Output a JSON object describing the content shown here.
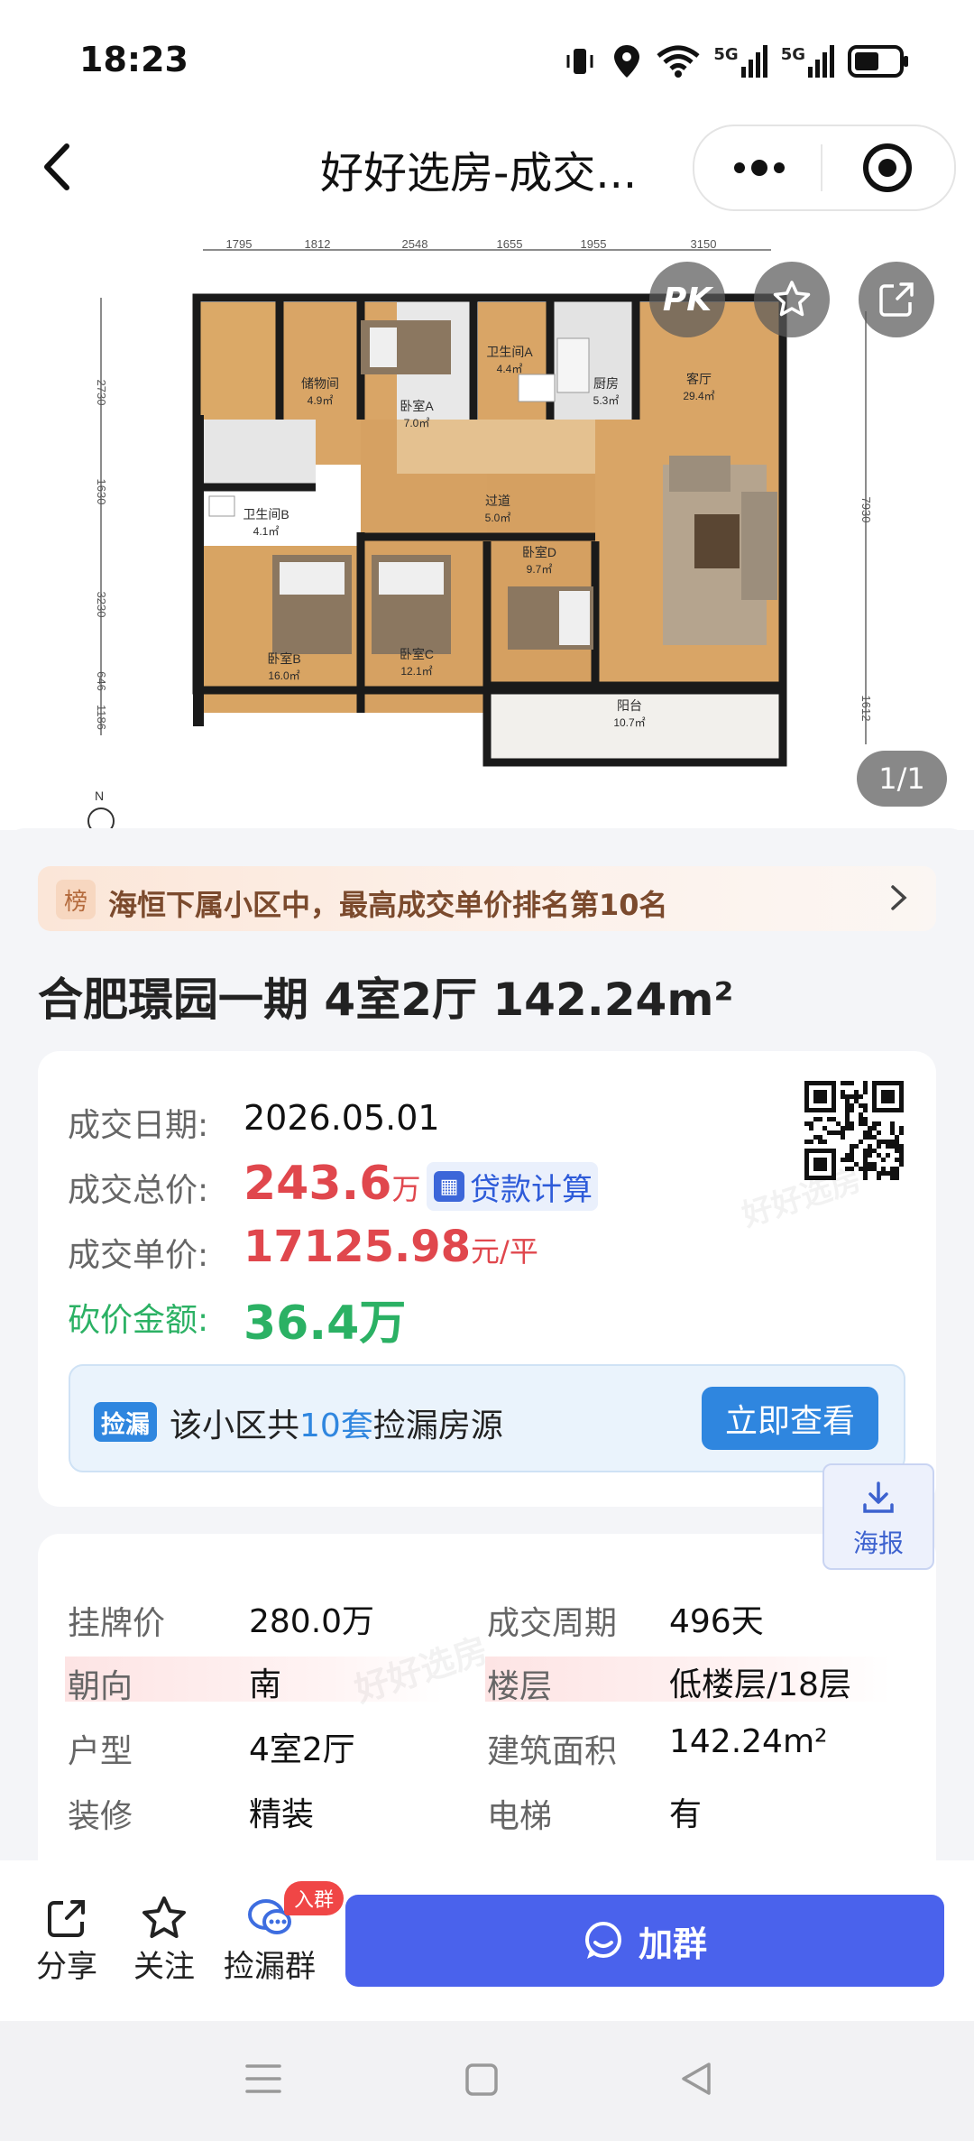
{
  "status": {
    "time": "18:23",
    "signal1": "5G",
    "signal2": "5G"
  },
  "nav": {
    "title": "好好选房-成交..."
  },
  "floorplan": {
    "top_dims": [
      "1795",
      "1812",
      "2548",
      "1655",
      "1955",
      "3150"
    ],
    "left_dims": [
      "2730",
      "1630",
      "3230",
      "646",
      "1186"
    ],
    "right_dims": [
      "7930",
      "1612"
    ],
    "rooms": [
      {
        "name": "储物间",
        "area": "4.9㎡"
      },
      {
        "name": "卧室A",
        "area": "7.0㎡"
      },
      {
        "name": "卫生间A",
        "area": "4.4㎡"
      },
      {
        "name": "厨房",
        "area": "5.3㎡"
      },
      {
        "name": "客厅",
        "area": "29.4㎡"
      },
      {
        "name": "卫生间B",
        "area": "4.1㎡"
      },
      {
        "name": "过道",
        "area": "5.0㎡"
      },
      {
        "name": "卧室D",
        "area": "9.7㎡"
      },
      {
        "name": "卧室B",
        "area": "16.0㎡"
      },
      {
        "name": "卧室C",
        "area": "12.1㎡"
      },
      {
        "name": "阳台",
        "area": "10.7㎡"
      }
    ],
    "compass": "N",
    "pk_label": "PK",
    "counter": "1/1"
  },
  "rank": {
    "badge": "榜",
    "text": "海恒下属小区中，最高成交单价排名第10名"
  },
  "listing": {
    "title": "合肥璟园一期 4室2厅 142.24m²"
  },
  "deal": {
    "date_label": "成交日期:",
    "date": "2026.05.01",
    "total_label": "成交总价:",
    "total": "243.6",
    "total_unit": "万",
    "loan_btn": "贷款计算",
    "unit_label": "成交单价:",
    "unit_price": "17125.98",
    "unit_price_unit": "元/平",
    "cut_label": "砍价金额:",
    "cut": "36.4万"
  },
  "leak": {
    "tag": "捡漏",
    "text_prefix": "该小区共",
    "count": "10套",
    "text_suffix": "捡漏房源",
    "button": "立即查看"
  },
  "poster": {
    "label": "海报"
  },
  "details": [
    {
      "k1": "挂牌价",
      "v1": "280.0万",
      "k2": "成交周期",
      "v2": "496天"
    },
    {
      "k1": "朝向",
      "v1": "南",
      "k2": "楼层",
      "v2": "低楼层/18层"
    },
    {
      "k1": "户型",
      "v1": "4室2厅",
      "k2": "建筑面积",
      "v2": "142.24m²"
    },
    {
      "k1": "装修",
      "v1": "精装",
      "k2": "电梯",
      "v2": "有"
    }
  ],
  "actions": {
    "share": "分享",
    "follow": "关注",
    "group": "捡漏群",
    "group_badge": "入群",
    "join": "加群"
  },
  "watermark": "好好选房"
}
